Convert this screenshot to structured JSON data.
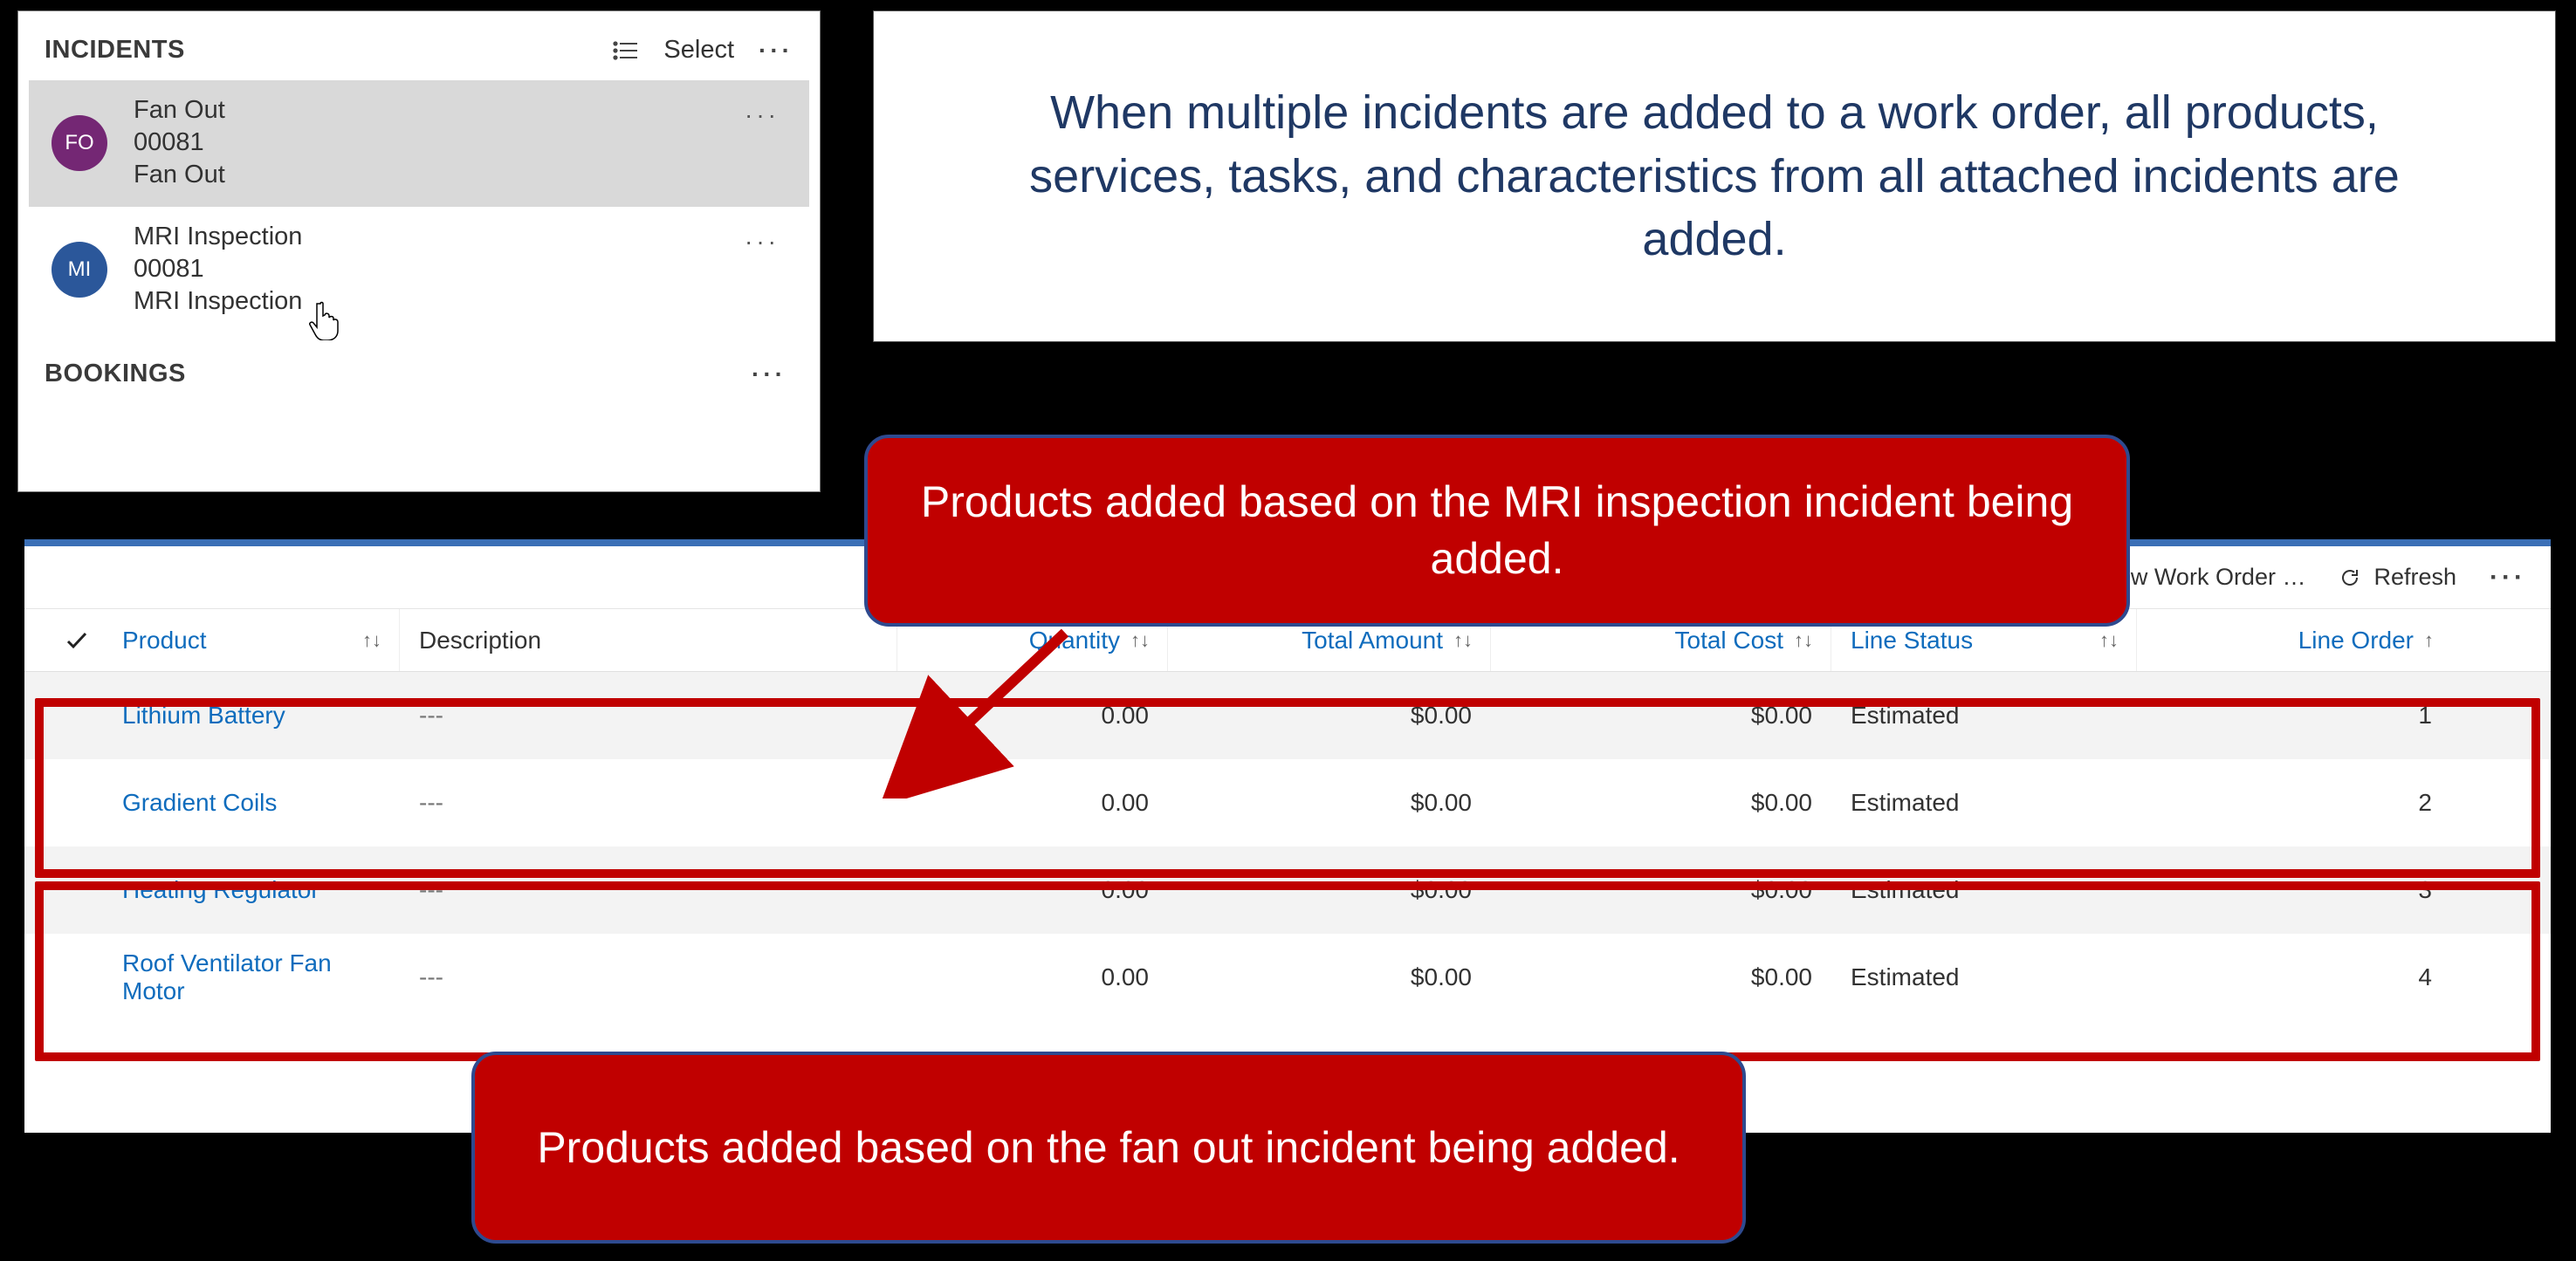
{
  "incidents_panel": {
    "title": "INCIDENTS",
    "select_label": "Select",
    "bookings_title": "BOOKINGS",
    "items": [
      {
        "avatar_initials": "FO",
        "avatar_color": "purple",
        "line1": "Fan Out",
        "line2": "00081",
        "line3": "Fan Out",
        "selected": true
      },
      {
        "avatar_initials": "MI",
        "avatar_color": "blue",
        "line1": "MRI Inspection",
        "line2": "00081",
        "line3": "MRI Inspection",
        "selected": false
      }
    ]
  },
  "caption_top": "When multiple incidents are added to a work order, all products, services, tasks, and characteristics from all attached incidents are added.",
  "callout_mid": "Products added based on the MRI inspection incident being added.",
  "callout_bot": "Products added based on the fan out incident being added.",
  "grid": {
    "toolbar": {
      "new_wo": "New Work Order …",
      "refresh": "Refresh"
    },
    "columns": {
      "product": "Product",
      "description": "Description",
      "quantity": "Quantity",
      "total_amount": "Total Amount",
      "total_cost": "Total Cost",
      "line_status": "Line Status",
      "line_order": "Line Order"
    },
    "rows": [
      {
        "product": "Lithium Battery",
        "description": "---",
        "quantity": "0.00",
        "total_amount": "$0.00",
        "total_cost": "$0.00",
        "line_status": "Estimated",
        "line_order": "1"
      },
      {
        "product": "Gradient Coils",
        "description": "---",
        "quantity": "0.00",
        "total_amount": "$0.00",
        "total_cost": "$0.00",
        "line_status": "Estimated",
        "line_order": "2"
      },
      {
        "product": "Heating Regulator",
        "description": "---",
        "quantity": "0.00",
        "total_amount": "$0.00",
        "total_cost": "$0.00",
        "line_status": "Estimated",
        "line_order": "3"
      },
      {
        "product": "Roof Ventilator Fan Motor",
        "description": "---",
        "quantity": "0.00",
        "total_amount": "$0.00",
        "total_cost": "$0.00",
        "line_status": "Estimated",
        "line_order": "4"
      }
    ]
  }
}
